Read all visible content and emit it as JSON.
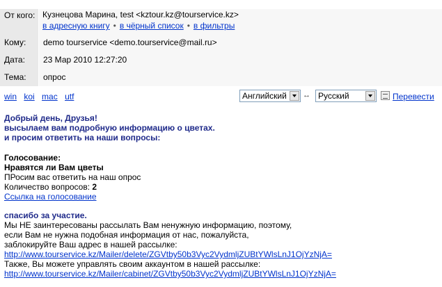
{
  "header": {
    "from_label": "От кого:",
    "from_value": "Кузнецова Марина, test <kztour.kz@tourservice.kz>",
    "from_links": [
      "в адресную книгу",
      "в чёрный список",
      "в фильтры"
    ],
    "to_label": "Кому:",
    "to_value": "demo tourservice <demo.tourservice@mail.ru>",
    "date_label": "Дата:",
    "date_value": "23 Мар 2010 12:27:20",
    "subject_label": "Тема:",
    "subject_value": "опрос"
  },
  "toolbar": {
    "encodings": [
      "win",
      "koi",
      "mac",
      "utf"
    ],
    "source_lang": "Английский",
    "target_lang": "Русский",
    "swap_glyph": "↔",
    "translate_label": "Перевести"
  },
  "body": {
    "greeting": [
      "Добрый день, Друзья!",
      "высылаем вам подробную информацию о цветах.",
      "и просим ответить на наши вопросы:"
    ],
    "vote_title": "Голосование:",
    "vote_question": "Нравятся ли Вам цветы",
    "vote_request": "ПРосим вас ответить на наш опрос",
    "vote_count_label": "Количество вопросов:",
    "vote_count": "2",
    "vote_link": "Ссылка на голосование",
    "thanks": "спасибо за участие.",
    "notice": [
      "Мы НЕ заинтересованы рассылать Вам ненужную информацию, поэтому,",
      "если Вам не нужна подобная информация от нас, пожалуйста,",
      "заблокируйте Ваш адрес в нашей рассылке:"
    ],
    "unsubscribe_url": "http://www.tourservice.kz/Mailer/delete/ZGVtby50b3Vyc2VydmljZUBtYWlsLnJ1OjYzNjA=",
    "cabinet_text": "Также, Вы можете управлять своим аккаунтом в нашей рассылке:",
    "cabinet_url": "http://www.tourservice.kz/Mailer/cabinet/ZGVtby50b3Vyc2VydmljZUBtYWlsLnJ1OjYzNjA="
  }
}
